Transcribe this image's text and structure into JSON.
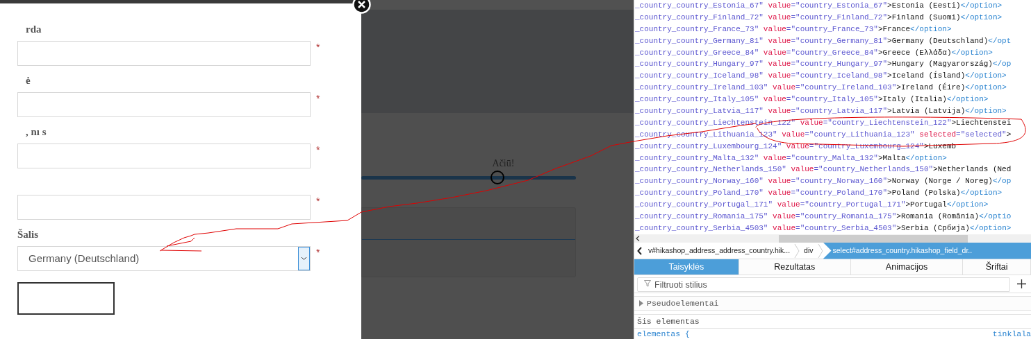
{
  "form": {
    "fields": [
      {
        "kind": "text",
        "label": "rda",
        "required_mark": "*"
      },
      {
        "kind": "text",
        "label": "ė",
        "required_mark": "*"
      },
      {
        "kind": "text",
        "label": ", nı s",
        "required_mark": "*"
      },
      {
        "kind": "text",
        "required_mark": "*"
      },
      {
        "kind": "select",
        "label": "Šalis",
        "value": "Germany (Deutschland)",
        "focused": true,
        "required_mark": "*"
      }
    ]
  },
  "background": {
    "thanks": "Ačiū!",
    "progress": {
      "level": 0.634
    }
  },
  "source": {
    "lines": [
      {
        "id": "_country_country_Estonia_67\" ",
        "attr": "value",
        "attr_value": "=\"country_Estonia_67\"",
        "text": ">Estonia (Eesti)",
        "close": "</option>"
      },
      {
        "id": "_country_country_Finland_72\" ",
        "attr": "value",
        "attr_value": "=\"country_Finland_72\"",
        "text": ">Finland (Suomi)",
        "close": "</option>"
      },
      {
        "id": "_country_country_France_73\" ",
        "attr": "value",
        "attr_value": "=\"country_France_73\"",
        "text": ">France",
        "close": "</option>"
      },
      {
        "id": "_country_country_Germany_81\" ",
        "attr": "value",
        "attr_value": "=\"country_Germany_81\"",
        "text": ">Germany (Deutschland)",
        "close": "</opt"
      },
      {
        "id": "_country_country_Greece_84\" ",
        "attr": "value",
        "attr_value": "=\"country_Greece_84\"",
        "text": ">Greece (Ελλάδα)",
        "close": "</option>"
      },
      {
        "id": "_country_country_Hungary_97\" ",
        "attr": "value",
        "attr_value": "=\"country_Hungary_97\"",
        "text": ">Hungary (Magyarország)",
        "close": "</op"
      },
      {
        "id": "_country_country_Iceland_98\" ",
        "attr": "value",
        "attr_value": "=\"country_Iceland_98\"",
        "text": ">Iceland (Ísland)",
        "close": "</option>"
      },
      {
        "id": "_country_country_Ireland_103\" ",
        "attr": "value",
        "attr_value": "=\"country_Ireland_103\"",
        "text": ">Ireland (Éire)",
        "close": "</option>"
      },
      {
        "id": "_country_country_Italy_105\" ",
        "attr": "value",
        "attr_value": "=\"country_Italy_105\"",
        "text": ">Italy (Italia)",
        "close": "</option>"
      },
      {
        "id": "_country_country_Latvia_117\" ",
        "attr": "value",
        "attr_value": "=\"country_Latvia_117\"",
        "text": ">Latvia (Latvija)",
        "close": "</option>"
      },
      {
        "id": "_country_country_Liechtenstein_122\" ",
        "attr": "value",
        "attr_value": "=\"country_Liechtenstein_122\"",
        "text": ">Liechtenstei"
      },
      {
        "id": "_country_country_Lithuania_123\" ",
        "attr": "value",
        "attr_value": "=\"country_Lithuania_123\"",
        "attr2": "selected",
        "attr2_value": "=\"selected\"",
        "text": ">"
      },
      {
        "id": "_country_country_Luxembourg_124\" ",
        "attr": "value",
        "attr_value": "=\"country_Luxembourg_124\"",
        "text": ">Luxemb"
      },
      {
        "id": "_country_country_Malta_132\" ",
        "attr": "value",
        "attr_value": "=\"country_Malta_132\"",
        "text": ">Malta",
        "close": "</option>"
      },
      {
        "id": "_country_country_Netherlands_150\" ",
        "attr": "value",
        "attr_value": "=\"country_Netherlands_150\"",
        "text": ">Netherlands (Ned"
      },
      {
        "id": "_country_country_Norway_160\" ",
        "attr": "value",
        "attr_value": "=\"country_Norway_160\"",
        "text": ">Norway (Norge / Noreg)",
        "close": "</op"
      },
      {
        "id": "_country_country_Poland_170\" ",
        "attr": "value",
        "attr_value": "=\"country_Poland_170\"",
        "text": ">Poland (Polska)",
        "close": "</option>"
      },
      {
        "id": "_country_country_Portugal_171\" ",
        "attr": "value",
        "attr_value": "=\"country_Portugal_171\"",
        "text": ">Portugal",
        "close": "</option>"
      },
      {
        "id": "_country_country_Romania_175\" ",
        "attr": "value",
        "attr_value": "=\"country_Romania_175\"",
        "text": ">Romania (România)",
        "close": "</optio"
      },
      {
        "id": "_country_country_Serbia_4503\" ",
        "attr": "value",
        "attr_value": "=\"country_Serbia_4503\"",
        "text": ">Serbia (Србија)",
        "close": "</option>"
      }
    ]
  },
  "breadcrumbs": [
    {
      "label": "v#hikashop_address_address_country.hik...",
      "selected": false
    },
    {
      "label": "div",
      "selected": false
    },
    {
      "label": "select#address_country.hikashop_field_dr..",
      "selected": true
    }
  ],
  "tabs": [
    {
      "label": "Taisyklės",
      "selected": true
    },
    {
      "label": "Rezultatas",
      "selected": false
    },
    {
      "label": "Animacijos",
      "selected": false
    },
    {
      "label": "Šriftai",
      "selected": false
    }
  ],
  "filter": {
    "placeholder": "Filtruoti stilius"
  },
  "rules": {
    "pseudo": "Pseudoelementai",
    "section": "Šis elementas",
    "selector": "elementas {",
    "source": "tinklala"
  }
}
